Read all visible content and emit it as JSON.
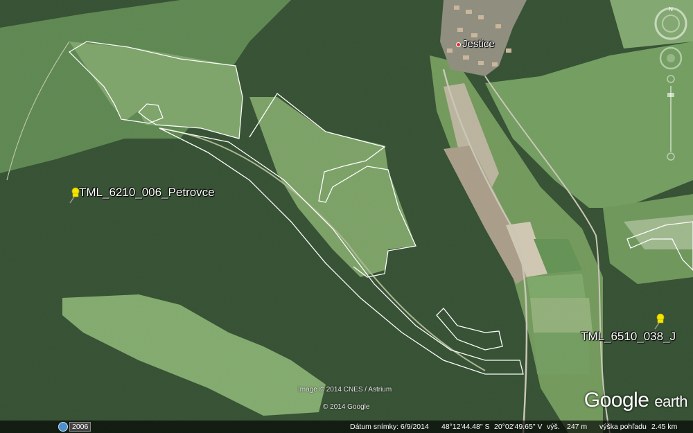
{
  "map": {
    "placemarks": [
      {
        "label": "TML_6210_006_Petrovce"
      },
      {
        "label": "TML_6510_038_J"
      }
    ],
    "town": {
      "label": "Jestice"
    },
    "credits": {
      "imagery": "Image © 2014 CNES / Astrium",
      "google": "© 2014 Google"
    },
    "logo": {
      "main": "Google",
      "sub": "earth"
    },
    "historical_year": "2006",
    "nav": {
      "north": "N"
    }
  },
  "statusbar": {
    "date_label": "Dátum snímky: 6/9/2014",
    "lat": "48°12'44.48\" S",
    "lon": "20°02'49.65\" V",
    "elev_label": "výš.",
    "elev": "247 m",
    "eye_label": "výška pohľadu",
    "eye": "2.45 km"
  },
  "colors": {
    "forest": "#2e4a2c",
    "meadow": "#6f9a5c",
    "field": "#a9a08a",
    "boundary": "#ffffff",
    "pin": "#f5e600"
  }
}
